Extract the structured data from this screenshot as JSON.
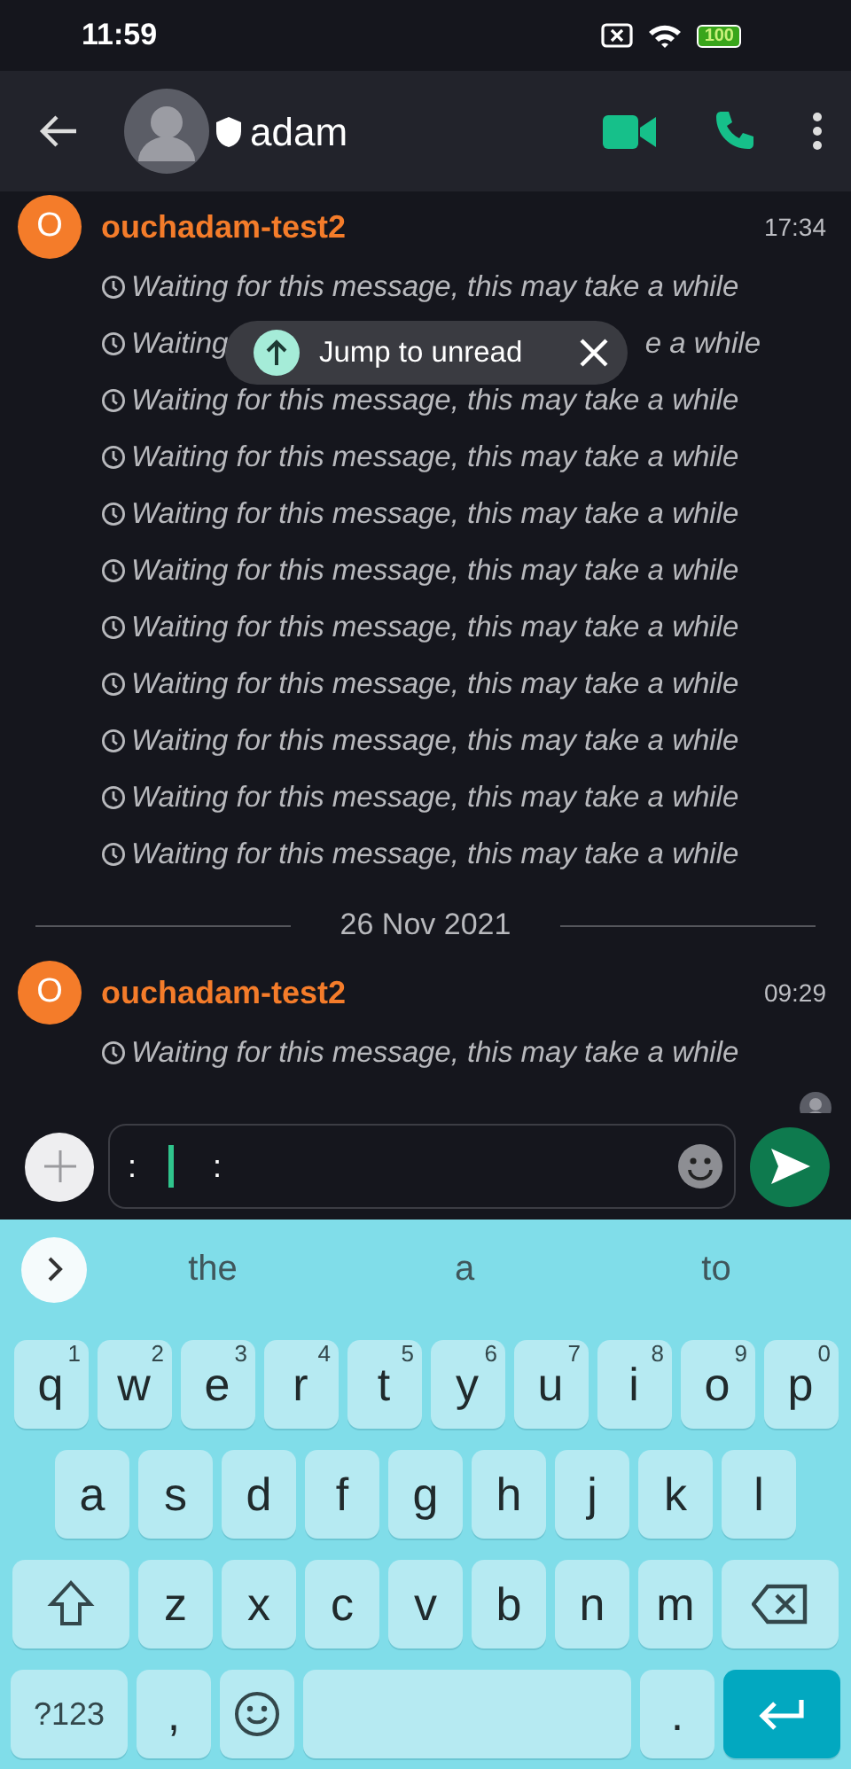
{
  "status_bar": {
    "time": "11:59",
    "battery": "100"
  },
  "header": {
    "name": "adam"
  },
  "toast": {
    "label": "Jump to unread"
  },
  "groups": [
    {
      "sender": "ouchadam-test2",
      "initial": "O",
      "time": "17:34",
      "messages": [
        {
          "kind": "full",
          "text": "Waiting for this message, this may take a while"
        },
        {
          "kind": "covered",
          "text": "Waiting",
          "text_end": "e a while"
        },
        {
          "kind": "full",
          "text": "Waiting for this message, this may take a while"
        },
        {
          "kind": "full",
          "text": "Waiting for this message, this may take a while"
        },
        {
          "kind": "full",
          "text": "Waiting for this message, this may take a while"
        },
        {
          "kind": "full",
          "text": "Waiting for this message, this may take a while"
        },
        {
          "kind": "full",
          "text": "Waiting for this message, this may take a while"
        },
        {
          "kind": "full",
          "text": "Waiting for this message, this may take a while"
        },
        {
          "kind": "full",
          "text": "Waiting for this message, this may take a while"
        },
        {
          "kind": "full",
          "text": "Waiting for this message, this may take a while"
        },
        {
          "kind": "full",
          "text": "Waiting for this message, this may take a while"
        }
      ]
    },
    {
      "divider": "26 Nov 2021",
      "sender": "ouchadam-test2",
      "initial": "O",
      "time": "09:29",
      "messages": [
        {
          "kind": "full",
          "text": "Waiting for this message, this may take a while"
        }
      ]
    }
  ],
  "composer": {
    "value_before": ":",
    "value_after": ":"
  },
  "keyboard": {
    "suggestions": [
      "the",
      "a",
      "to"
    ],
    "rows": [
      {
        "keys": [
          {
            "kind": "letter",
            "label": "q",
            "hint": "1"
          },
          {
            "kind": "letter",
            "label": "w",
            "hint": "2"
          },
          {
            "kind": "letter",
            "label": "e",
            "hint": "3"
          },
          {
            "kind": "letter",
            "label": "r",
            "hint": "4"
          },
          {
            "kind": "letter",
            "label": "t",
            "hint": "5"
          },
          {
            "kind": "letter",
            "label": "y",
            "hint": "6"
          },
          {
            "kind": "letter",
            "label": "u",
            "hint": "7"
          },
          {
            "kind": "letter",
            "label": "i",
            "hint": "8"
          },
          {
            "kind": "letter",
            "label": "o",
            "hint": "9"
          },
          {
            "kind": "letter",
            "label": "p",
            "hint": "0"
          }
        ]
      },
      {
        "keys": [
          {
            "kind": "letter",
            "label": "a"
          },
          {
            "kind": "letter",
            "label": "s"
          },
          {
            "kind": "letter",
            "label": "d"
          },
          {
            "kind": "letter",
            "label": "f"
          },
          {
            "kind": "letter",
            "label": "g"
          },
          {
            "kind": "letter",
            "label": "h"
          },
          {
            "kind": "letter",
            "label": "j"
          },
          {
            "kind": "letter",
            "label": "k"
          },
          {
            "kind": "letter",
            "label": "l"
          }
        ]
      },
      {
        "keys": [
          {
            "kind": "shift"
          },
          {
            "kind": "letter",
            "label": "z"
          },
          {
            "kind": "letter",
            "label": "x"
          },
          {
            "kind": "letter",
            "label": "c"
          },
          {
            "kind": "letter",
            "label": "v"
          },
          {
            "kind": "letter",
            "label": "b"
          },
          {
            "kind": "letter",
            "label": "n"
          },
          {
            "kind": "letter",
            "label": "m"
          },
          {
            "kind": "backspace"
          }
        ]
      },
      {
        "keys": [
          {
            "kind": "symbols",
            "label": "?123"
          },
          {
            "kind": "letter",
            "label": ","
          },
          {
            "kind": "emoji"
          },
          {
            "kind": "space"
          },
          {
            "kind": "letter",
            "label": "."
          },
          {
            "kind": "enter"
          }
        ]
      }
    ]
  }
}
